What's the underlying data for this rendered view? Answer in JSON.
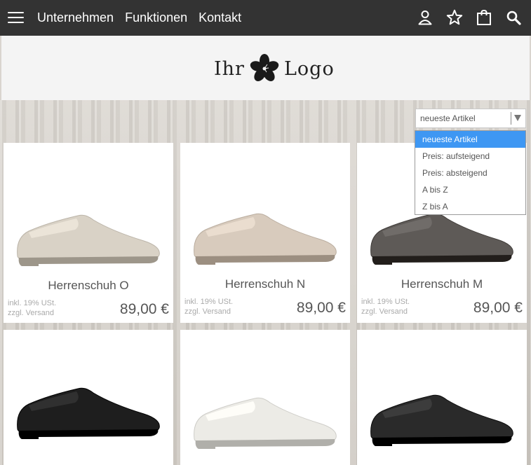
{
  "nav": {
    "links": [
      "Unternehmen",
      "Funktionen",
      "Kontakt"
    ],
    "icons": [
      "user-icon",
      "star-icon",
      "shopping-bag-icon",
      "search-icon"
    ]
  },
  "logo": {
    "left_text": "Ihr",
    "right_text": "Logo"
  },
  "sort": {
    "selected": "neueste Artikel",
    "options": [
      "neueste Artikel",
      "Preis: aufsteigend",
      "Preis: absteigend",
      "A bis Z",
      "Z bis A"
    ]
  },
  "products": [
    {
      "name": "Herrenschuh O",
      "tax": "inkl. 19% USt.",
      "shipping": "zzgl. Versand",
      "price": "89,00 €",
      "color": "#d9d2c6"
    },
    {
      "name": "Herrenschuh N",
      "tax": "inkl. 19% USt.",
      "shipping": "zzgl. Versand",
      "price": "89,00 €",
      "color": "#d8cbbd"
    },
    {
      "name": "Herrenschuh M",
      "tax": "inkl. 19% USt.",
      "shipping": "zzgl. Versand",
      "price": "89,00 €",
      "color": "#5e5a57"
    },
    {
      "color": "#1e1e1e"
    },
    {
      "color": "#ecebe6"
    },
    {
      "color": "#2a2a2a"
    }
  ],
  "colors": {
    "nav_bg": "#333333",
    "header_bg": "#f4f4f4",
    "accent": "#3e97f3"
  }
}
